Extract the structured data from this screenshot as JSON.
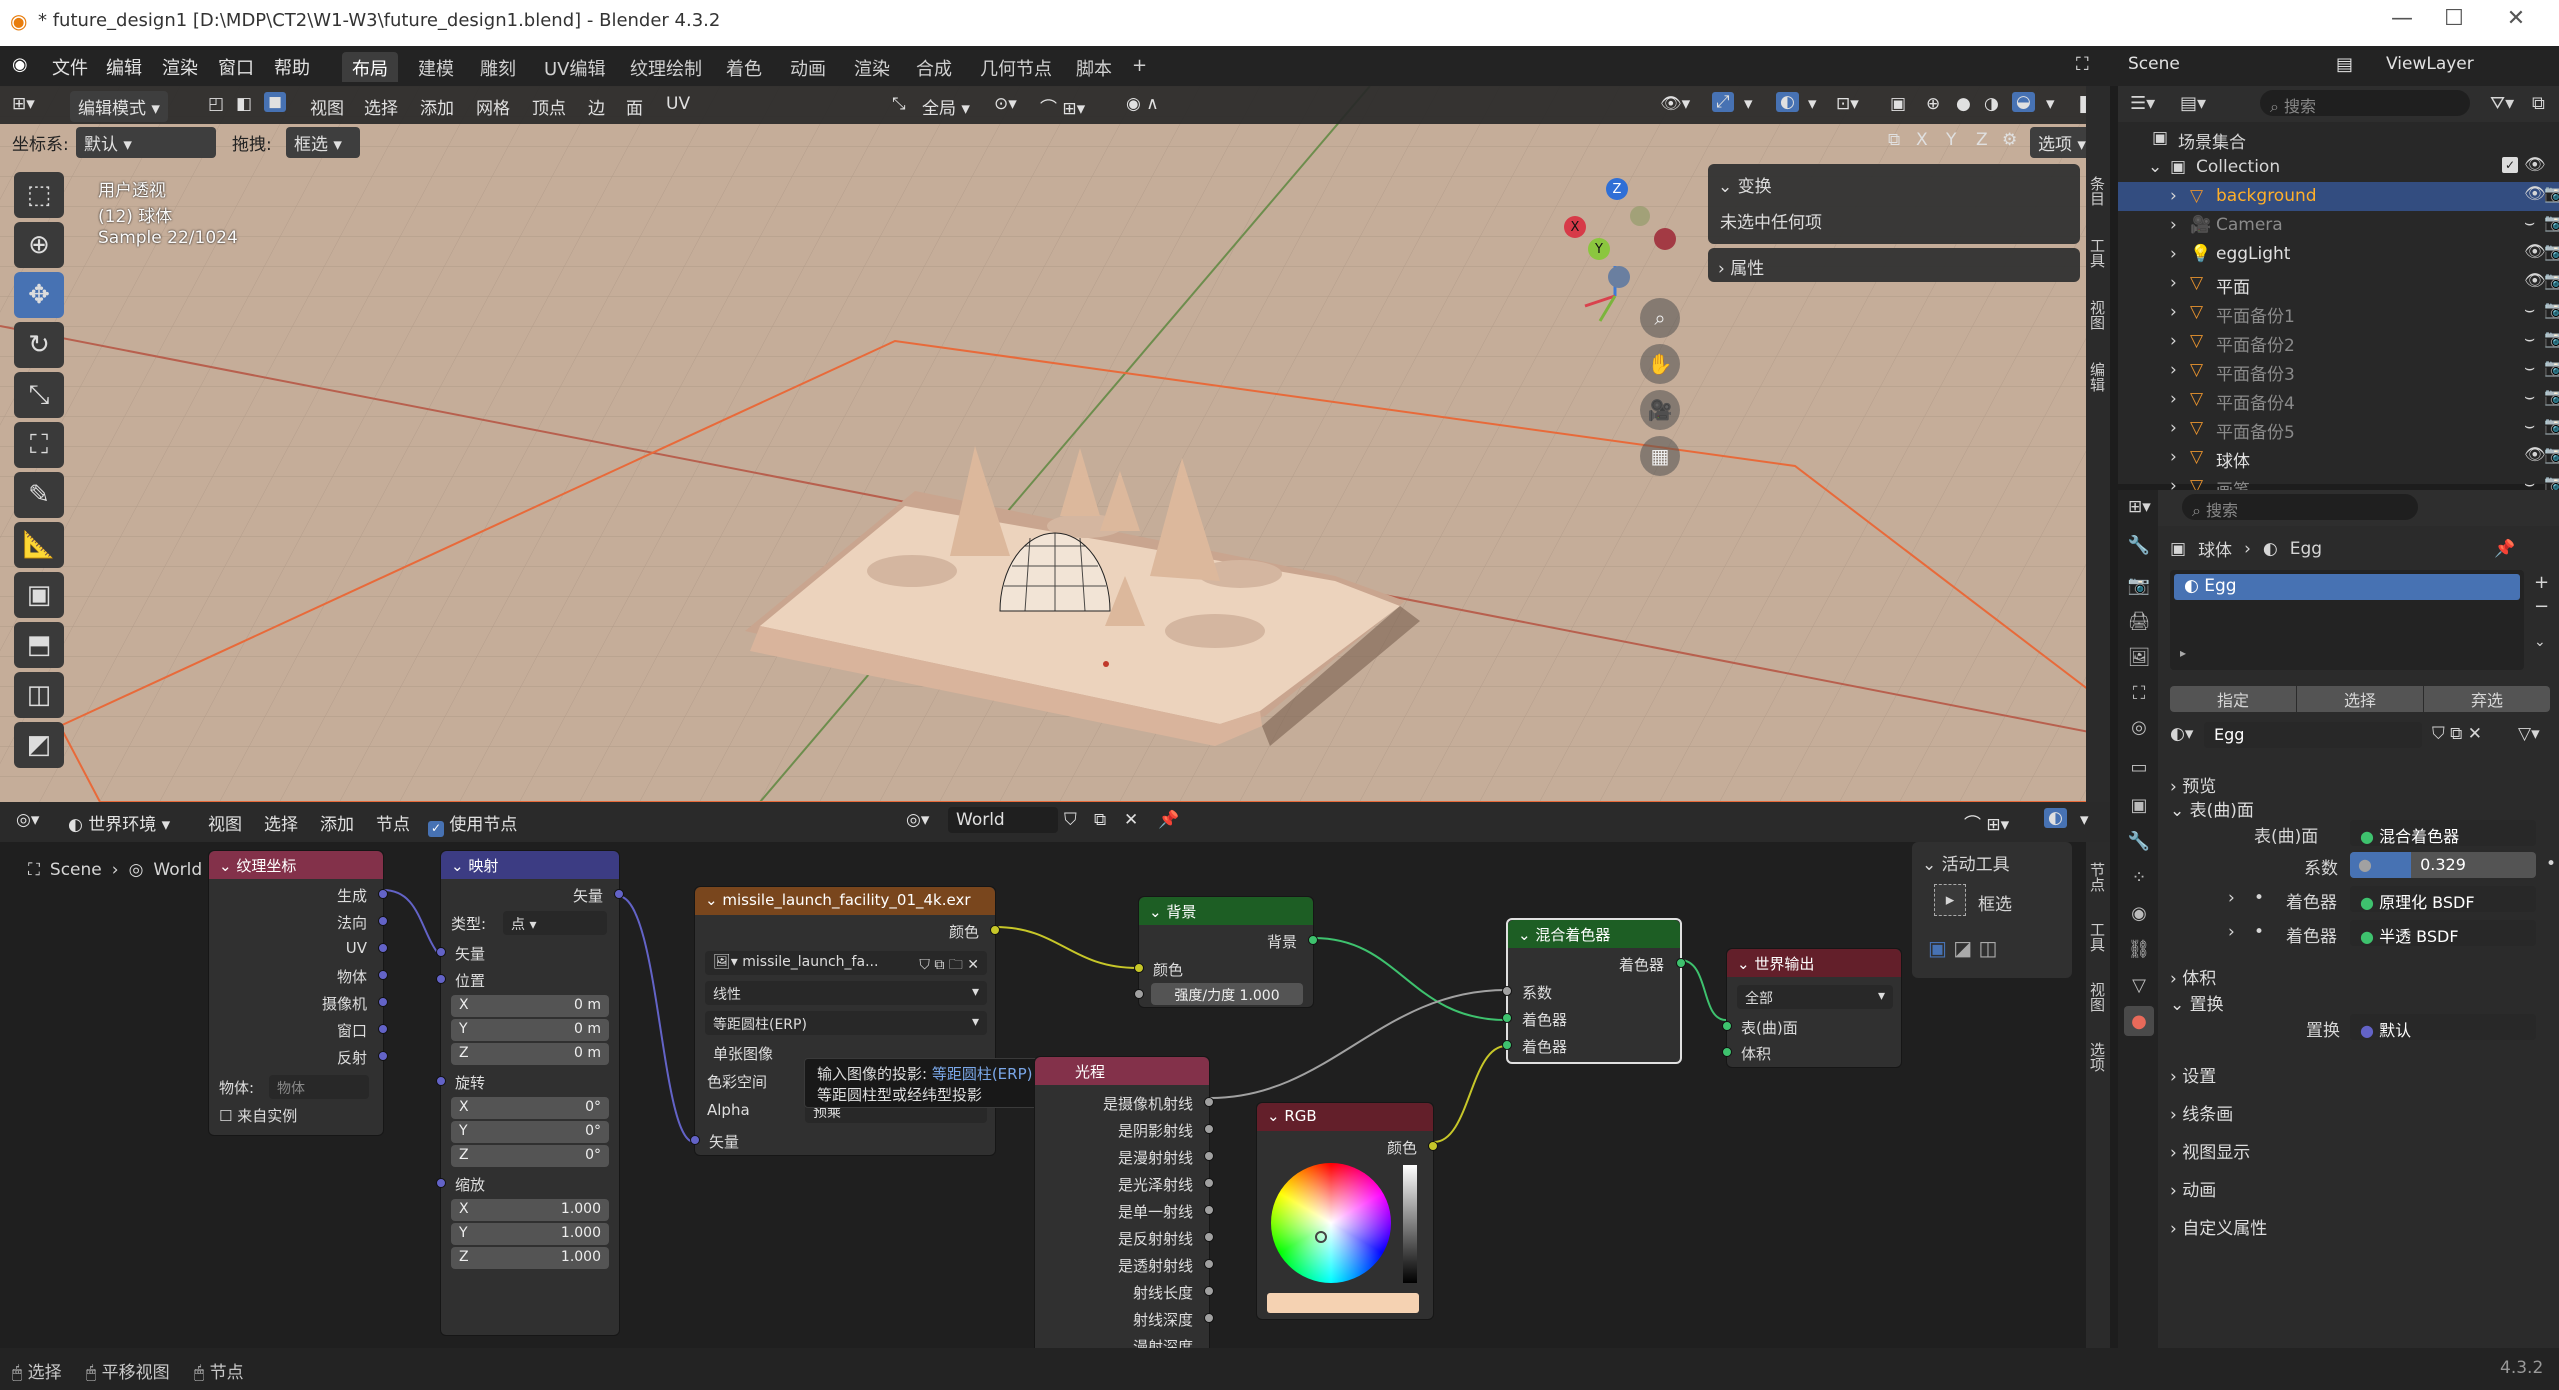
{
  "titlebar": {
    "title": "* future_design1 [D:\\MDP\\CT2\\W1-W3\\future_design1.blend] - Blender 4.3.2"
  },
  "menu": {
    "items": [
      "文件",
      "编辑",
      "渲染",
      "窗口",
      "帮助"
    ]
  },
  "workspaces": {
    "tabs": [
      "布局",
      "建模",
      "雕刻",
      "UV编辑",
      "纹理绘制",
      "着色",
      "动画",
      "渲染",
      "合成",
      "几何节点",
      "脚本"
    ],
    "active": "布局",
    "add": "+"
  },
  "topright": {
    "scene": "Scene",
    "viewlayer": "ViewLayer"
  },
  "viewport": {
    "mode": "编辑模式",
    "menus": [
      "视图",
      "选择",
      "添加",
      "网格",
      "顶点",
      "边",
      "面",
      "UV"
    ],
    "transform_orient": "全局",
    "coord_label": "坐标系:",
    "coord_value": "默认",
    "drag_label": "拖拽:",
    "drag_value": "框选",
    "options": "选项",
    "axes": [
      "X",
      "Y",
      "Z"
    ],
    "overlay_lines": [
      "用户透视",
      "(12) 球体",
      "Sample 22/1024"
    ],
    "npanel": {
      "transform": "变换",
      "nothing_selected": "未选中任何项",
      "properties": "属性"
    },
    "gizmo": {
      "x": "X",
      "y": "Y",
      "z": "Z"
    },
    "side_tabs": [
      "条目",
      "工具",
      "视图",
      "编辑"
    ]
  },
  "node_editor": {
    "type": "世界环境",
    "menus": [
      "视图",
      "选择",
      "添加",
      "节点"
    ],
    "use_nodes_label": "使用节点",
    "world_name": "World",
    "breadcrumb": [
      "Scene",
      "World"
    ],
    "active_tool_title": "活动工具",
    "active_tool_name": "框选",
    "side_tabs": [
      "节点",
      "工具",
      "视图",
      "选项"
    ],
    "tooltip": {
      "line1_prefix": "输入图像的投影: ",
      "line1_value": "等距圆柱(ERP)",
      "line2": "等距圆柱型或经纬型投影"
    },
    "nodes": {
      "texcoord": {
        "title": "纹理坐标",
        "outputs": [
          "生成",
          "法向",
          "UV",
          "物体",
          "摄像机",
          "窗口",
          "反射"
        ],
        "object_label": "物体:",
        "object_placeholder": "物体",
        "from_instancer": "来自实例"
      },
      "mapping": {
        "title": "映射",
        "out": "矢量",
        "type_label": "类型:",
        "type_value": "点",
        "vector": "矢量",
        "location": "位置",
        "rotation": "旋转",
        "scale": "缩放",
        "loc": [
          {
            "a": "X",
            "v": "0 m"
          },
          {
            "a": "Y",
            "v": "0 m"
          },
          {
            "a": "Z",
            "v": "0 m"
          }
        ],
        "rot": [
          {
            "a": "X",
            "v": "0°"
          },
          {
            "a": "Y",
            "v": "0°"
          },
          {
            "a": "Z",
            "v": "0°"
          }
        ],
        "scl": [
          {
            "a": "X",
            "v": "1.000"
          },
          {
            "a": "Y",
            "v": "1.000"
          },
          {
            "a": "Z",
            "v": "1.000"
          }
        ]
      },
      "envtex": {
        "title": "missile_launch_facility_01_4k.exr",
        "out": "颜色",
        "image": "missile_launch_fa...",
        "interp": "线性",
        "proj": "等距圆柱(ERP)",
        "single": "单张图像",
        "colorspace": "色彩空间",
        "alpha": "Alpha",
        "alpha_val": "预乘",
        "vector": "矢量"
      },
      "background": {
        "title": "背景",
        "out": "背景",
        "color": "颜色",
        "strength_label": "强度/力度",
        "strength": "1.000"
      },
      "lightpath": {
        "title": "光程",
        "outputs": [
          "是摄像机射线",
          "是阴影射线",
          "是漫射射线",
          "是光泽射线",
          "是单一射线",
          "是反射射线",
          "是透射射线",
          "射线长度",
          "射线深度",
          "漫射深度"
        ]
      },
      "rgb": {
        "title": "RGB",
        "out": "颜色"
      },
      "mix": {
        "title": "混合着色器",
        "out": "着色器",
        "fac": "系数",
        "s1": "着色器",
        "s2": "着色器"
      },
      "output": {
        "title": "世界输出",
        "target": "全部",
        "surface": "表(曲)面",
        "volume": "体积"
      }
    }
  },
  "outliner": {
    "search_placeholder": "搜索",
    "root": "场景集合",
    "collection": "Collection",
    "items": [
      {
        "name": "background",
        "selected": true
      },
      {
        "name": "Camera",
        "dim": true
      },
      {
        "name": "eggLight"
      },
      {
        "name": "平面"
      },
      {
        "name": "平面备份1",
        "dim": true
      },
      {
        "name": "平面备份2",
        "dim": true
      },
      {
        "name": "平面备份3",
        "dim": true
      },
      {
        "name": "平面备份4",
        "dim": true
      },
      {
        "name": "平面备份5",
        "dim": true
      },
      {
        "name": "球体"
      },
      {
        "name": "画笔",
        "dim": true
      }
    ]
  },
  "properties": {
    "search_placeholder": "搜索",
    "breadcrumb": [
      "球体",
      "Egg"
    ],
    "material_slot": "Egg",
    "slot_buttons": [
      "指定",
      "选择",
      "弃选"
    ],
    "material_name": "Egg",
    "sections": {
      "preview": "预览",
      "surface": "表(曲)面",
      "volume": "体积",
      "displacement": "置换",
      "settings": "设置",
      "lineart": "线条画",
      "viewport_display": "视图显示",
      "animation": "动画",
      "custom": "自定义属性"
    },
    "surface_label": "表(曲)面",
    "surface_value": "混合着色器",
    "fac_label": "系数",
    "fac_value": "0.329",
    "fac_fraction": 0.329,
    "shader_label": "着色器",
    "shader1": "原理化 BSDF",
    "shader2": "半透 BSDF",
    "displacement_label": "置换",
    "displacement_value": "默认"
  },
  "statusbar": {
    "items": [
      "选择",
      "平移视图",
      "节点"
    ],
    "version": "4.3.2"
  },
  "colors": {
    "accent": "#4772b3",
    "texcoord_header": "#83314a",
    "mapping_header": "#3c3c83",
    "env_header": "#79461d",
    "bg_header": "#1d5e24",
    "output_header": "#631f2a",
    "rgb_header": "#631f2a",
    "viewport_bg": "#c5ad99"
  }
}
